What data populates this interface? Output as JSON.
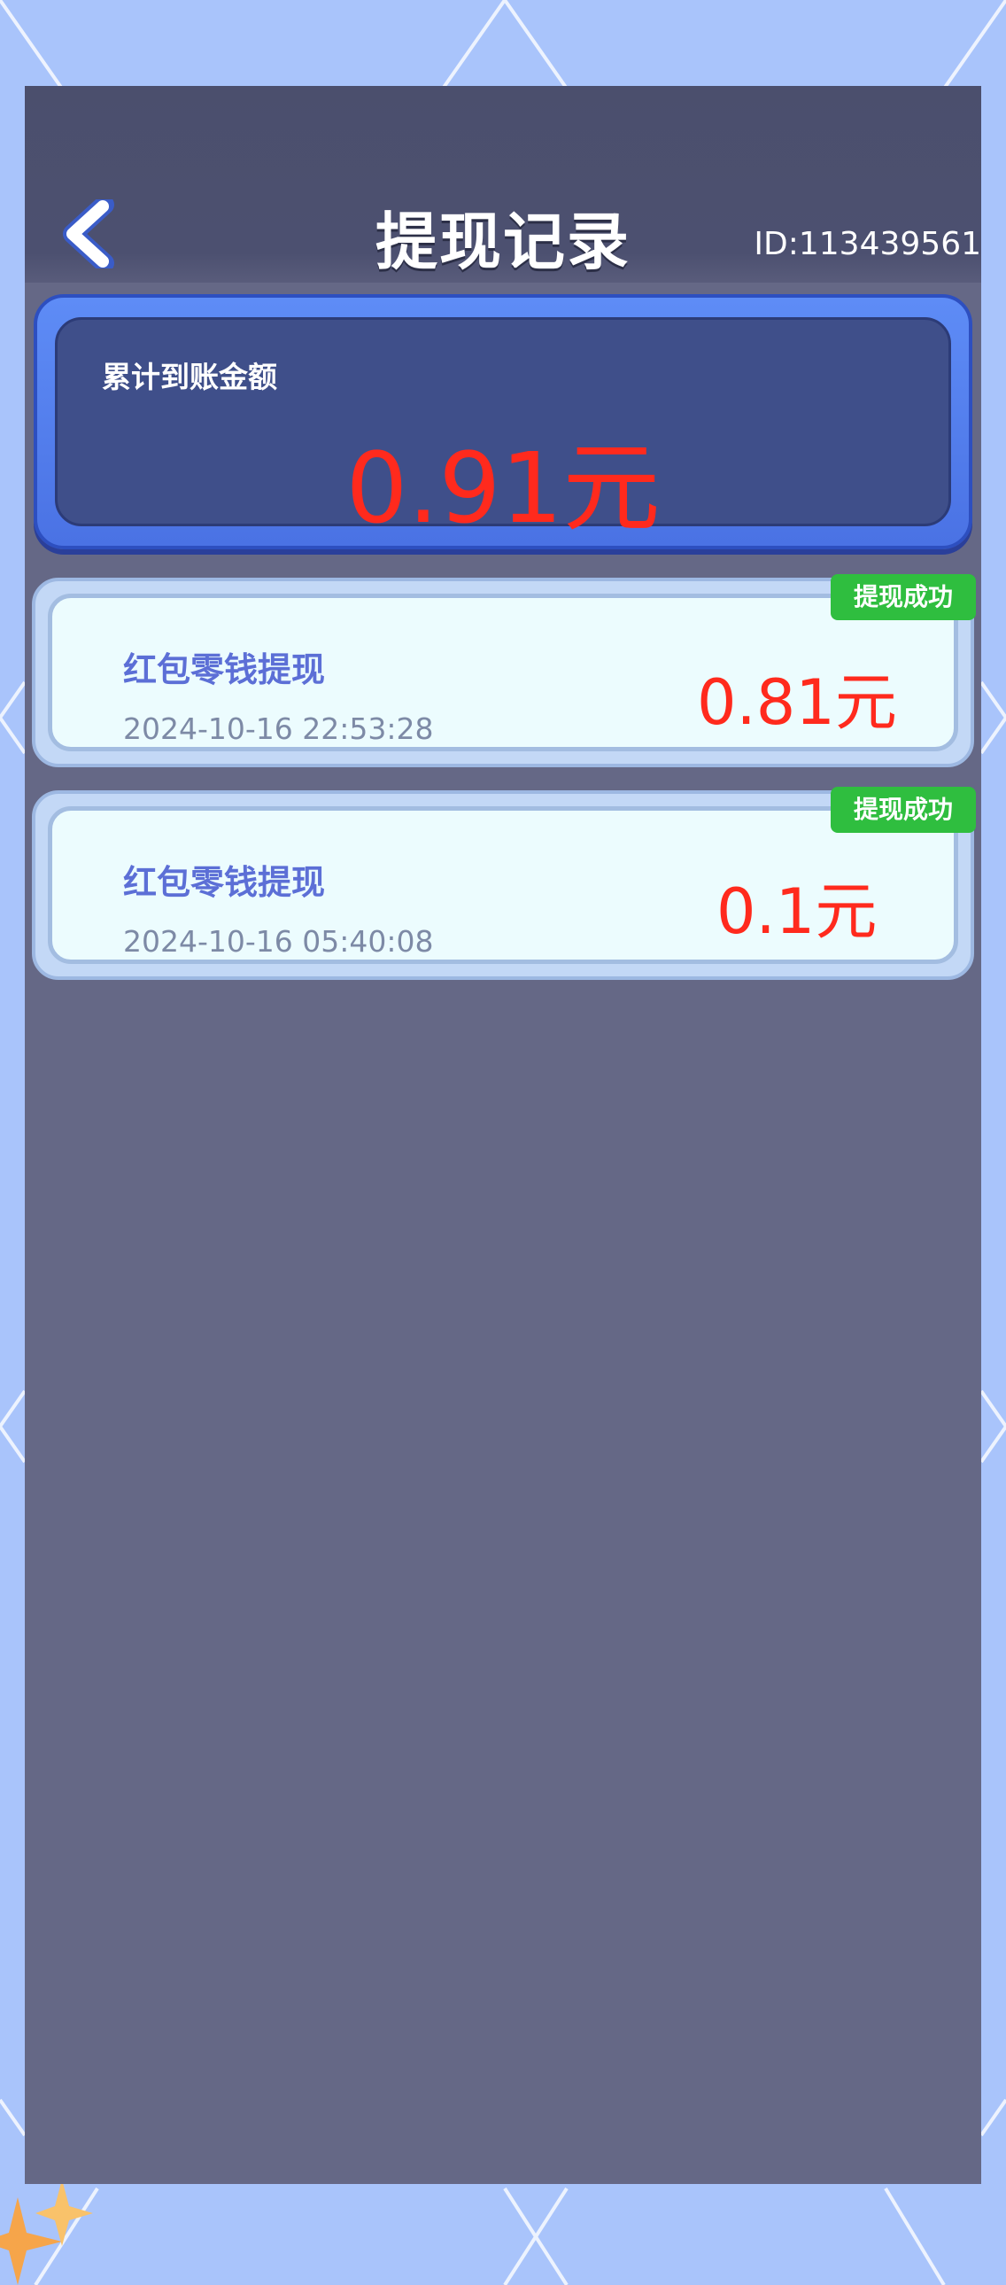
{
  "header": {
    "title": "提现记录",
    "user_id": "ID:113439561"
  },
  "summary": {
    "label": "累计到账金额",
    "amount": "0.91元"
  },
  "records": [
    {
      "title": "红包零钱提现",
      "time": "2024-10-16 22:53:28",
      "amount": "0.81元",
      "status": "提现成功"
    },
    {
      "title": "红包零钱提现",
      "time": "2024-10-16 05:40:08",
      "amount": "0.1元",
      "status": "提现成功"
    }
  ],
  "colors": {
    "amount": "#ff2a1d",
    "badge": "#2fbe3f",
    "panel": "#656886",
    "background": "#a9c4fb"
  }
}
